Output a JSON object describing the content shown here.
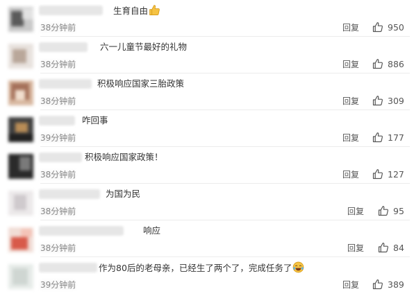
{
  "comments": [
    {
      "text": "生育自由",
      "emoji": "thumbs-up-emoji",
      "time": "38分钟前",
      "reply": "回复",
      "likes": "950"
    },
    {
      "text": "六一儿童节最好的礼物",
      "time": "38分钟前",
      "reply": "回复",
      "likes": "886"
    },
    {
      "text": "积极响应国家三胎政策",
      "time": "38分钟前",
      "reply": "回复",
      "likes": "309"
    },
    {
      "text": "咋回事",
      "time": "39分钟前",
      "reply": "回复",
      "likes": "177"
    },
    {
      "text": "积极响应国家政策！",
      "time": "38分钟前",
      "reply": "回复",
      "likes": "127"
    },
    {
      "text": "为国为民",
      "time": "38分钟前",
      "reply": "回复",
      "likes": "95"
    },
    {
      "text": "响应",
      "time": "38分钟前",
      "reply": "回复",
      "likes": "84"
    },
    {
      "text": "作为80后的老母亲，已经生了两个了，完成任务了",
      "emoji": "laughing-tears-emoji",
      "time": "39分钟前",
      "reply": "回复",
      "likes": "389"
    }
  ],
  "icons": {
    "like": "thumbs-up-outline-icon"
  },
  "colors": {
    "text": "#333333",
    "meta": "#888888",
    "action": "#555555",
    "divider": "#ececec"
  }
}
